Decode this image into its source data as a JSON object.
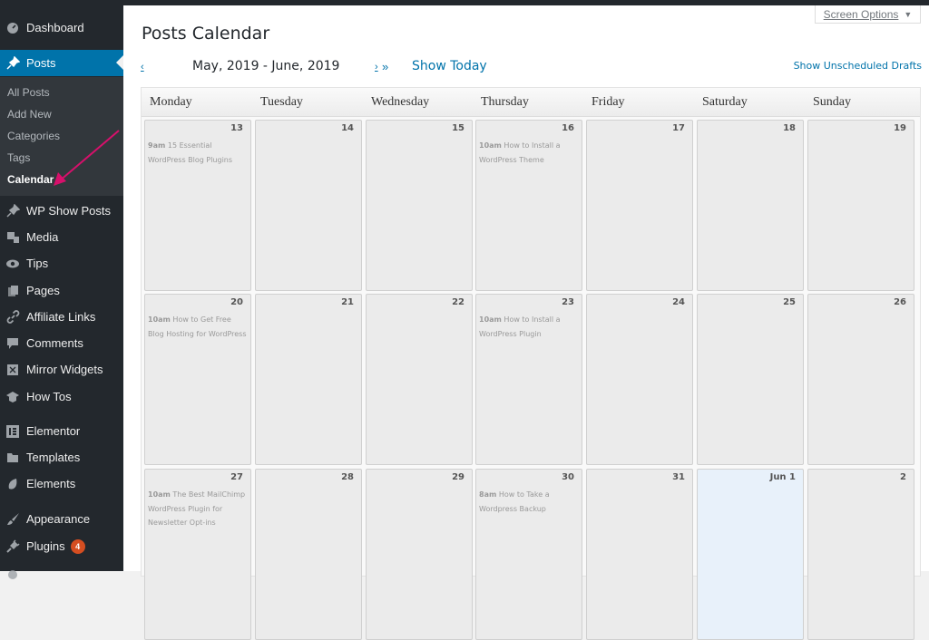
{
  "sidebar": {
    "items": [
      {
        "label": "Dashboard",
        "icon": "dashboard-icon"
      },
      {
        "label": "Posts",
        "icon": "pin-icon",
        "active": true
      },
      {
        "label": "WP Show Posts",
        "icon": "pin-icon"
      },
      {
        "label": "Media",
        "icon": "media-icon"
      },
      {
        "label": "Tips",
        "icon": "eye-icon"
      },
      {
        "label": "Pages",
        "icon": "pages-icon"
      },
      {
        "label": "Affiliate Links",
        "icon": "link-icon"
      },
      {
        "label": "Comments",
        "icon": "comment-icon"
      },
      {
        "label": "Mirror Widgets",
        "icon": "widgets-icon"
      },
      {
        "label": "How Tos",
        "icon": "graduation-cap-icon"
      },
      {
        "label": "Elementor",
        "icon": "elementor-icon"
      },
      {
        "label": "Templates",
        "icon": "folder-icon"
      },
      {
        "label": "Elements",
        "icon": "leaf-icon"
      },
      {
        "label": "Appearance",
        "icon": "brush-icon"
      },
      {
        "label": "Plugins",
        "icon": "plug-icon",
        "badge": "4"
      }
    ],
    "submenu": [
      "All Posts",
      "Add New",
      "Categories",
      "Tags",
      "Calendar"
    ],
    "current_submenu": "Calendar"
  },
  "header": {
    "title": "Posts Calendar",
    "screen_options": "Screen Options",
    "prev_link": "‹",
    "range": "May, 2019 - June, 2019",
    "next_link": "›",
    "next_double": "»",
    "show_today": "Show Today",
    "show_unscheduled": "Show Unscheduled Drafts"
  },
  "calendar": {
    "days": [
      "Monday",
      "Tuesday",
      "Wednesday",
      "Thursday",
      "Friday",
      "Saturday",
      "Sunday"
    ],
    "weeks": [
      [
        {
          "date": "13",
          "posts": [
            {
              "time": "9am",
              "title": "15 Essential WordPress Blog Plugins"
            }
          ]
        },
        {
          "date": "14",
          "posts": []
        },
        {
          "date": "15",
          "posts": []
        },
        {
          "date": "16",
          "posts": [
            {
              "time": "10am",
              "title": "How to Install a WordPress Theme"
            }
          ]
        },
        {
          "date": "17",
          "posts": []
        },
        {
          "date": "18",
          "posts": []
        },
        {
          "date": "19",
          "posts": []
        }
      ],
      [
        {
          "date": "20",
          "posts": [
            {
              "time": "10am",
              "title": "How to Get Free Blog Hosting for WordPress"
            }
          ]
        },
        {
          "date": "21",
          "posts": []
        },
        {
          "date": "22",
          "posts": []
        },
        {
          "date": "23",
          "posts": [
            {
              "time": "10am",
              "title": "How to Install a WordPress Plugin"
            }
          ]
        },
        {
          "date": "24",
          "posts": []
        },
        {
          "date": "25",
          "posts": []
        },
        {
          "date": "26",
          "posts": []
        }
      ],
      [
        {
          "date": "27",
          "posts": [
            {
              "time": "10am",
              "title": "The Best MailChimp WordPress Plugin for Newsletter Opt-ins"
            }
          ]
        },
        {
          "date": "28",
          "posts": []
        },
        {
          "date": "29",
          "posts": []
        },
        {
          "date": "30",
          "posts": [
            {
              "time": "8am",
              "title": "How to Take a Wordpress Backup"
            }
          ]
        },
        {
          "date": "31",
          "posts": []
        },
        {
          "date": "Jun 1",
          "posts": [],
          "today": true
        },
        {
          "date": "2",
          "posts": []
        }
      ]
    ]
  },
  "colors": {
    "accent": "#0073aa",
    "sidebar": "#23282d",
    "badge": "#d54e21",
    "annotation_arrow": "#d6106b"
  }
}
